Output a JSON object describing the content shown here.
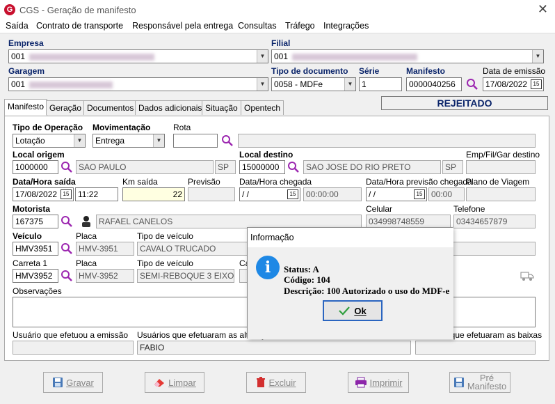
{
  "window": {
    "title": "CGS - Geração de manifesto"
  },
  "menu": [
    "Saída",
    "Contrato de transporte",
    "Responsável pela entrega",
    "Consultas",
    "Tráfego",
    "Integrações"
  ],
  "header": {
    "empresa_label": "Empresa",
    "empresa_value": "001",
    "filial_label": "Filial",
    "filial_value": "001",
    "garagem_label": "Garagem",
    "garagem_value": "001",
    "tipo_doc_label": "Tipo de documento",
    "tipo_doc_value": "0058 - MDFe",
    "serie_label": "Série",
    "serie_value": "1",
    "manifesto_label": "Manifesto",
    "manifesto_value": "0000040256",
    "data_emissao_label": "Data de emissão",
    "data_emissao_value": "17/08/2022"
  },
  "status": "REJEITADO",
  "tabs": [
    "Manifesto",
    "Geração",
    "Documentos",
    "Dados adicionais",
    "Situação",
    "Opentech"
  ],
  "form": {
    "tipo_operacao_label": "Tipo de Operação",
    "tipo_operacao_value": "Lotação",
    "movimentacao_label": "Movimentação",
    "movimentacao_value": "Entrega",
    "rota_label": "Rota",
    "local_origem_label": "Local origem",
    "local_origem_code": "1000000",
    "local_origem_name": "SAO PAULO",
    "local_origem_uf": "SP",
    "local_destino_label": "Local destino",
    "local_destino_code": "15000000",
    "local_destino_name": "SAO JOSE DO RIO PRETO",
    "local_destino_uf": "SP",
    "emp_fil_gar_label": "Emp/Fil/Gar destino",
    "data_saida_label": "Data/Hora saída",
    "data_saida_value": "17/08/2022",
    "hora_saida_value": "11:22",
    "km_saida_label": "Km saída",
    "km_saida_value": "22",
    "previsao_label": "Previsão",
    "chegada_label": "Data/Hora chegada",
    "chegada_date": " / /",
    "chegada_time": "00:00:00",
    "prev_chegada_label": "Data/Hora previsão chegada",
    "prev_chegada_date": " / /",
    "prev_chegada_time": "00:00",
    "plano_viagem_label": "Plano de Viagem",
    "motorista_label": "Motorista",
    "motorista_code": "167375",
    "motorista_name": "RAFAEL CANELOS",
    "celular_label": "Celular",
    "celular_value": "034998748559",
    "telefone_label": "Telefone",
    "telefone_value": "03434657879",
    "veiculo_label": "Veículo",
    "veiculo_code": "HMV3951",
    "placa_label": "Placa",
    "placa_value": "HMV-3951",
    "tipo_veiculo_label": "Tipo de veículo",
    "tipo_veiculo_value": "CAVALO TRUCADO",
    "carreta_label": "Carreta 1",
    "carreta_code": "HMV3952",
    "carreta_placa": "HMV-3952",
    "carreta_tipo": "SEMI-REBOQUE 3 EIXOS",
    "carreta_ca_label": "Ca",
    "observacoes_label": "Observações",
    "usuario_emissao_label": "Usuário que efetuou a emissão",
    "usuarios_alteracoes_label": "Usuários que efetuaram as alterações",
    "usuarios_alteracoes_value": "FABIO",
    "usuarios_baixas_label": "Usuários que efetuaram as baixas"
  },
  "buttons": {
    "gravar": "Gravar",
    "limpar": "Limpar",
    "excluir": "Excluir",
    "imprimir": "Imprimir",
    "pre_manifesto_1": "Pré",
    "pre_manifesto_2": "Manifesto"
  },
  "dialog": {
    "title": "Informação",
    "status_line": "Status: A",
    "codigo_line": "Código: 104",
    "descricao_line": "Descrição: 100 Autorizado o uso do MDF-e",
    "ok_label": "Ok"
  },
  "colors": {
    "accent": "#0a246a",
    "brand": "#c8102e",
    "info": "#1e88e5",
    "search": "#9c27b0"
  }
}
